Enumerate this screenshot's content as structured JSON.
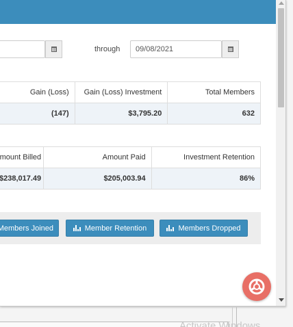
{
  "colors": {
    "header": "#3c8dbc",
    "button": "#3c8dbc",
    "fab": "#e86f66",
    "row_highlight": "#eef3f8"
  },
  "date_range": {
    "start_value": "",
    "start_icon": "calendar-icon",
    "through_label": "through",
    "end_value": "09/08/2021",
    "end_icon": "calendar-icon"
  },
  "summary_table": {
    "headers": [
      "Gain (Loss)",
      "Gain (Loss) Investment",
      "Total Members"
    ],
    "row": [
      "(147)",
      "$3,795.20",
      "632"
    ]
  },
  "billing_table": {
    "headers": [
      "mount Billed",
      "Amount Paid",
      "Investment Retention"
    ],
    "row": [
      "$238,017.49",
      "$205,003.94",
      "86%"
    ]
  },
  "actions": {
    "members_joined": "Members Joined",
    "member_retention": "Member Retention",
    "members_dropped": "Members Dropped",
    "icon": "bar-chart-icon"
  },
  "fab_icon": "help-lifebuoy-icon",
  "watermark": "Activate Windows"
}
